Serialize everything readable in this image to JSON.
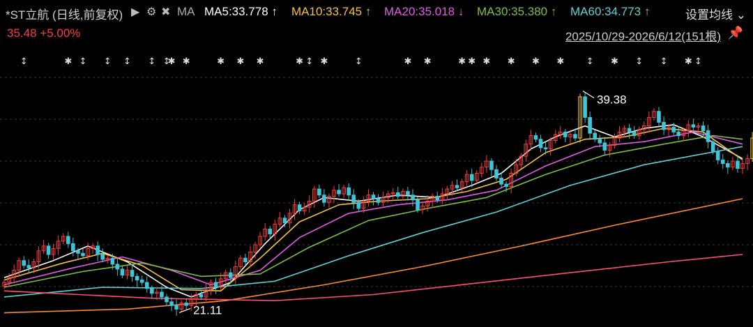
{
  "header": {
    "title": "*ST立航 (日线,前复权)",
    "play_icon": "play-icon",
    "gear_icon": "gear-icon",
    "close_icon": "close-icon",
    "ma_label": "MA",
    "settings_label": "设置均线",
    "settings_icon": "chevron-down-icon",
    "ma_items": [
      {
        "label": "MA5:33.778",
        "arrow": "↑",
        "color": "#ffffff"
      },
      {
        "label": "MA10:33.745",
        "arrow": "↑",
        "color": "#f5c342"
      },
      {
        "label": "MA20:35.018",
        "arrow": "↓",
        "color": "#e05ce8"
      },
      {
        "label": "MA30:35.380",
        "arrow": "↑",
        "color": "#7fbf3f"
      },
      {
        "label": "MA60:34.773",
        "arrow": "↑",
        "color": "#5fd3d3"
      }
    ]
  },
  "quote": {
    "price": "35.48",
    "change": "+5.00%",
    "range": "2025/10/29-2026/6/12(151根)",
    "pin_icon": "pin-icon"
  },
  "colors": {
    "up": "#ff3b3b",
    "down": "#3ec6d8",
    "limit_up": "#f5c342",
    "ma5": "#ffffff",
    "ma10": "#f5c342",
    "ma20": "#e05ce8",
    "ma30": "#7fbf3f",
    "ma60": "#5fd3d3",
    "ma120": "#ff8a2b",
    "ma250": "#ff4d7a"
  },
  "chart_data": {
    "type": "candlestick",
    "bar_count": 151,
    "ylim": [
      20.5,
      40.5
    ],
    "annotations": [
      {
        "text": "39.38",
        "index": 117,
        "value": 39.38
      },
      {
        "text": "21.11",
        "index": 35,
        "value": 21.11
      }
    ],
    "event_markers": [
      {
        "index": 4,
        "symbol": "↕"
      },
      {
        "index": 13,
        "symbol": "✱"
      },
      {
        "index": 16,
        "symbol": "↕"
      },
      {
        "index": 21,
        "symbol": "↕"
      },
      {
        "index": 25,
        "symbol": "↕"
      },
      {
        "index": 30,
        "symbol": "↕"
      },
      {
        "index": 33,
        "symbol": "↕"
      },
      {
        "index": 34,
        "symbol": "✱"
      },
      {
        "index": 37,
        "symbol": "✱"
      },
      {
        "index": 44,
        "symbol": "✱"
      },
      {
        "index": 48,
        "symbol": "✱"
      },
      {
        "index": 52,
        "symbol": "✱"
      },
      {
        "index": 60,
        "symbol": "✱"
      },
      {
        "index": 62,
        "symbol": "↕"
      },
      {
        "index": 65,
        "symbol": "✱"
      },
      {
        "index": 72,
        "symbol": "↕"
      },
      {
        "index": 82,
        "symbol": "✱"
      },
      {
        "index": 86,
        "symbol": "✱"
      },
      {
        "index": 93,
        "symbol": "✱"
      },
      {
        "index": 95,
        "symbol": "✱"
      },
      {
        "index": 98,
        "symbol": "✱"
      },
      {
        "index": 103,
        "symbol": "✱"
      },
      {
        "index": 108,
        "symbol": "✱"
      },
      {
        "index": 113,
        "symbol": "✱"
      },
      {
        "index": 119,
        "symbol": "↕"
      },
      {
        "index": 124,
        "symbol": "✱"
      },
      {
        "index": 129,
        "symbol": "↕"
      },
      {
        "index": 134,
        "symbol": "↕"
      },
      {
        "index": 139,
        "symbol": "✱"
      },
      {
        "index": 141,
        "symbol": "↕"
      }
    ],
    "closes": [
      23.6,
      24.0,
      24.6,
      25.4,
      25.0,
      24.8,
      25.3,
      26.2,
      26.6,
      25.9,
      26.4,
      27.0,
      27.4,
      26.8,
      26.2,
      26.0,
      25.8,
      26.4,
      26.6,
      25.9,
      25.5,
      25.6,
      25.1,
      24.7,
      24.2,
      24.6,
      24.1,
      23.8,
      23.6,
      23.1,
      22.7,
      22.8,
      22.4,
      22.0,
      21.7,
      21.4,
      21.9,
      21.7,
      22.2,
      22.6,
      22.4,
      23.0,
      23.6,
      23.2,
      23.9,
      24.4,
      24.0,
      24.9,
      25.6,
      25.3,
      26.1,
      26.7,
      27.4,
      28.0,
      27.6,
      28.4,
      28.9,
      28.5,
      29.3,
      30.0,
      29.5,
      29.8,
      30.3,
      31.3,
      30.8,
      30.2,
      30.7,
      31.2,
      30.9,
      31.4,
      30.8,
      30.2,
      29.7,
      30.3,
      30.8,
      30.5,
      30.2,
      30.6,
      30.9,
      31.0,
      30.7,
      31.1,
      30.8,
      30.4,
      29.6,
      29.9,
      30.3,
      30.7,
      30.4,
      30.9,
      31.3,
      31.6,
      31.4,
      31.9,
      32.5,
      32.0,
      32.6,
      33.1,
      33.6,
      32.9,
      32.2,
      31.7,
      31.5,
      32.6,
      33.3,
      34.0,
      35.0,
      35.7,
      35.4,
      34.7,
      34.6,
      35.3,
      35.8,
      36.0,
      35.6,
      35.8,
      35.5,
      38.9,
      37.2,
      35.9,
      35.4,
      35.1,
      34.5,
      34.9,
      35.5,
      36.0,
      36.3,
      36.0,
      35.7,
      36.2,
      36.5,
      37.2,
      37.7,
      36.8,
      36.2,
      36.4,
      36.0,
      35.7,
      36.1,
      36.6,
      36.4,
      36.5,
      36.1,
      35.2,
      34.4,
      33.7,
      33.4,
      33.1,
      33.6,
      33.0,
      33.4,
      33.8,
      35.5
    ],
    "ma_lines": [
      {
        "name": "MA5",
        "values": [
          [
            0,
            24.0
          ],
          [
            10,
            25.4
          ],
          [
            17,
            26.6
          ],
          [
            25,
            25.3
          ],
          [
            33,
            23.2
          ],
          [
            38,
            22.4
          ],
          [
            46,
            23.6
          ],
          [
            53,
            26.8
          ],
          [
            60,
            29.6
          ],
          [
            65,
            30.6
          ],
          [
            72,
            30.3
          ],
          [
            80,
            30.8
          ],
          [
            88,
            30.6
          ],
          [
            95,
            31.6
          ],
          [
            101,
            32.6
          ],
          [
            107,
            34.6
          ],
          [
            112,
            35.6
          ],
          [
            118,
            36.5
          ],
          [
            124,
            35.6
          ],
          [
            130,
            36.3
          ],
          [
            136,
            36.6
          ],
          [
            142,
            35.6
          ],
          [
            150,
            33.8
          ]
        ]
      },
      {
        "name": "MA10",
        "values": [
          [
            0,
            23.8
          ],
          [
            12,
            25.2
          ],
          [
            20,
            26.0
          ],
          [
            28,
            25.0
          ],
          [
            36,
            23.0
          ],
          [
            44,
            22.9
          ],
          [
            52,
            25.6
          ],
          [
            60,
            28.6
          ],
          [
            68,
            30.0
          ],
          [
            76,
            30.3
          ],
          [
            86,
            30.5
          ],
          [
            94,
            31.1
          ],
          [
            102,
            32.1
          ],
          [
            110,
            34.3
          ],
          [
            118,
            35.4
          ],
          [
            126,
            35.6
          ],
          [
            134,
            36.3
          ],
          [
            142,
            36.0
          ],
          [
            150,
            33.7
          ]
        ]
      },
      {
        "name": "MA20",
        "values": [
          [
            0,
            23.4
          ],
          [
            14,
            24.8
          ],
          [
            24,
            25.7
          ],
          [
            34,
            24.6
          ],
          [
            42,
            23.4
          ],
          [
            52,
            24.6
          ],
          [
            60,
            27.3
          ],
          [
            70,
            29.3
          ],
          [
            80,
            30.0
          ],
          [
            90,
            30.4
          ],
          [
            100,
            31.2
          ],
          [
            110,
            33.2
          ],
          [
            120,
            34.8
          ],
          [
            130,
            35.2
          ],
          [
            140,
            36.0
          ],
          [
            150,
            35.0
          ]
        ]
      },
      {
        "name": "MA30",
        "values": [
          [
            0,
            23.2
          ],
          [
            16,
            24.5
          ],
          [
            28,
            25.2
          ],
          [
            40,
            24.1
          ],
          [
            52,
            24.3
          ],
          [
            62,
            26.5
          ],
          [
            74,
            28.7
          ],
          [
            86,
            29.7
          ],
          [
            98,
            30.6
          ],
          [
            110,
            32.5
          ],
          [
            122,
            34.1
          ],
          [
            134,
            35.0
          ],
          [
            144,
            35.7
          ],
          [
            150,
            35.4
          ]
        ]
      },
      {
        "name": "MA60",
        "values": [
          [
            0,
            22.4
          ],
          [
            20,
            23.2
          ],
          [
            40,
            23.1
          ],
          [
            55,
            23.7
          ],
          [
            70,
            25.8
          ],
          [
            85,
            27.7
          ],
          [
            100,
            29.4
          ],
          [
            115,
            31.6
          ],
          [
            130,
            33.3
          ],
          [
            150,
            34.8
          ]
        ]
      },
      {
        "name": "MA120",
        "values": [
          [
            0,
            21.1
          ],
          [
            25,
            21.4
          ],
          [
            45,
            22.1
          ],
          [
            65,
            23.4
          ],
          [
            85,
            24.9
          ],
          [
            105,
            26.6
          ],
          [
            125,
            28.4
          ],
          [
            150,
            30.5
          ]
        ]
      },
      {
        "name": "MA250",
        "values": [
          [
            0,
            22.9
          ],
          [
            30,
            22.3
          ],
          [
            55,
            22.1
          ],
          [
            75,
            22.6
          ],
          [
            95,
            23.5
          ],
          [
            115,
            24.4
          ],
          [
            135,
            25.3
          ],
          [
            150,
            25.9
          ]
        ]
      }
    ]
  }
}
